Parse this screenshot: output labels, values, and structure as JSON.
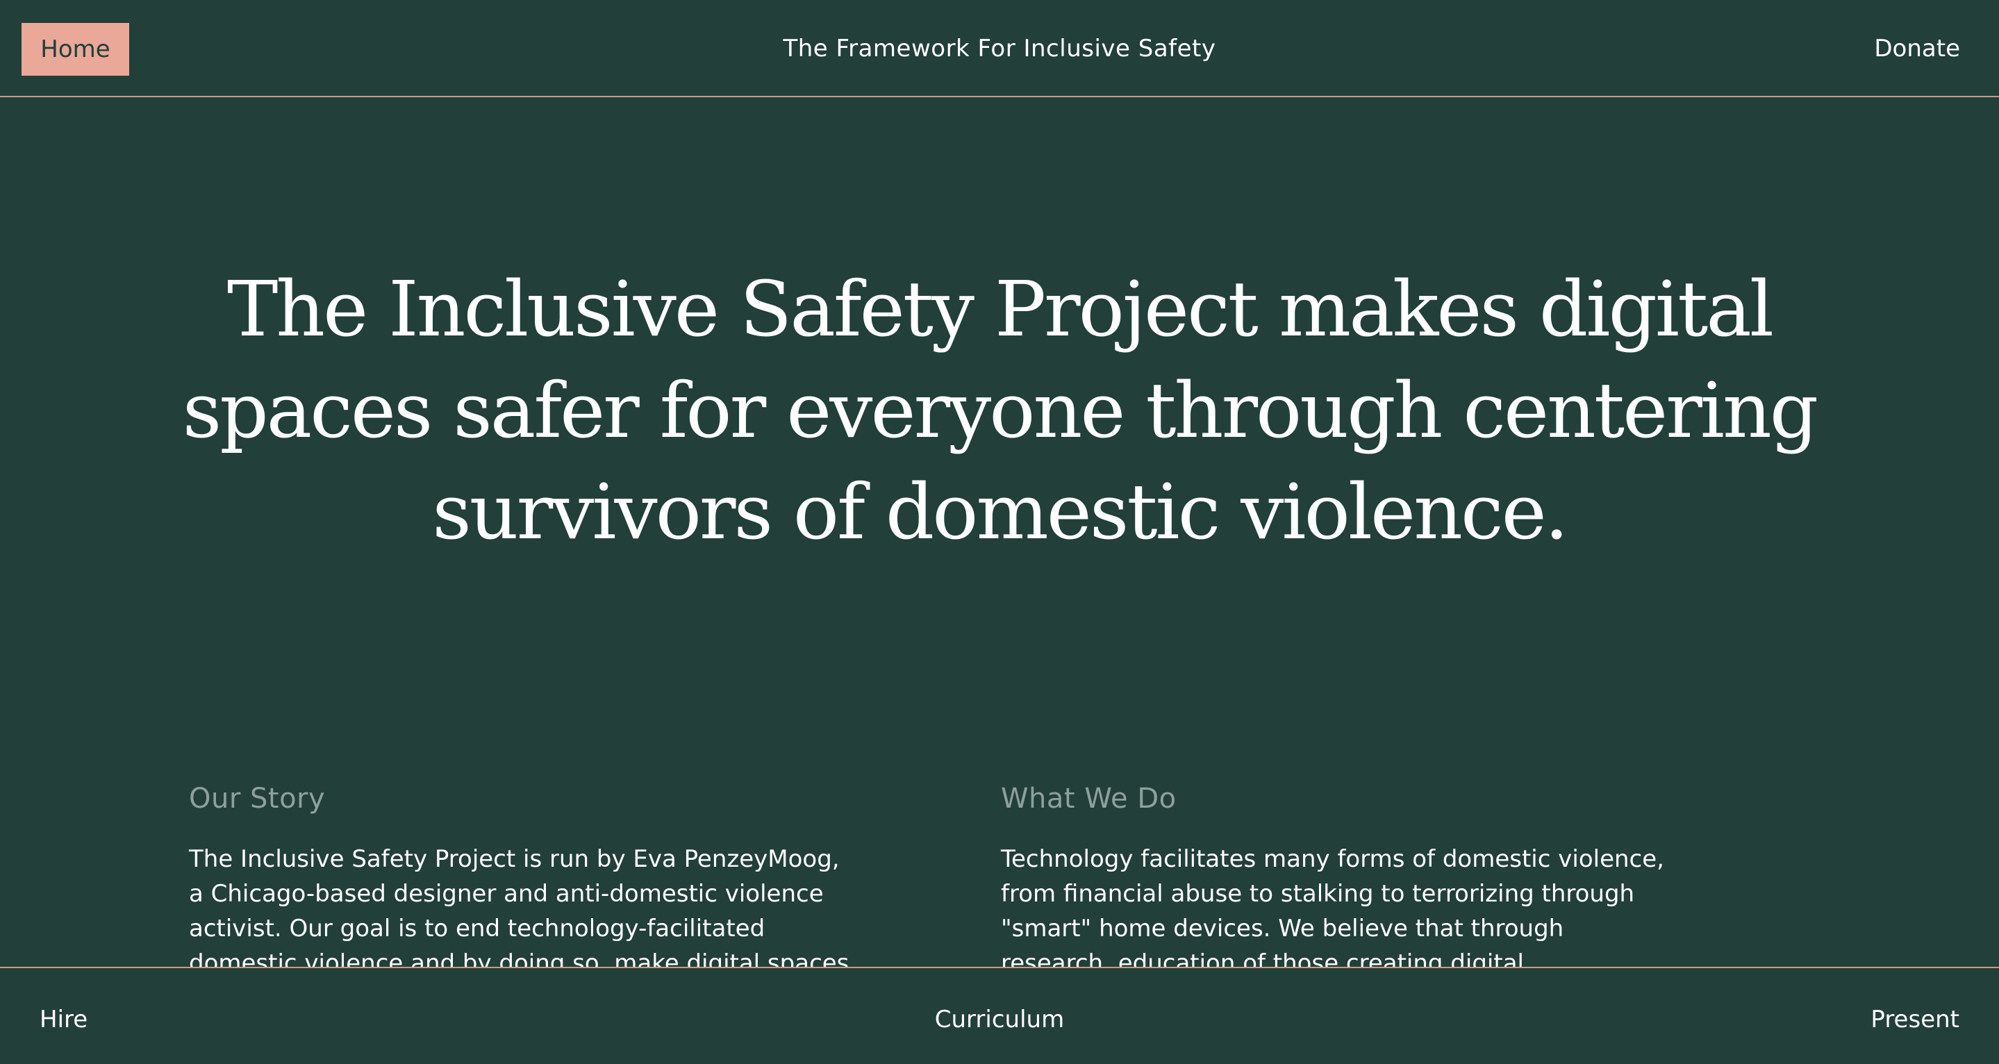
{
  "nav": {
    "home_label": "Home",
    "site_title": "The Framework For Inclusive Safety",
    "donate_label": "Donate"
  },
  "hero": {
    "headline": "The Inclusive Safety Project makes digital spaces safer for everyone through centering survivors of domestic violence."
  },
  "sections": {
    "our_story": {
      "heading": "Our Story",
      "body": "The Inclusive Safety Project is run by Eva PenzeyMoog, a Chicago-based designer and anti-domestic violence activist. Our goal is to end technology-facilitated domestic violence and by doing so, make digital spaces"
    },
    "what_we_do": {
      "heading": "What We Do",
      "body": "Technology facilitates many forms of domestic violence, from financial abuse to stalking to terrorizing through \"smart\" home devices. We believe that through research, education of those creating digital"
    }
  },
  "footer_nav": {
    "hire_label": "Hire",
    "curriculum_label": "Curriculum",
    "present_label": "Present"
  },
  "colors": {
    "background": "#223f39",
    "accent": "#e9a898",
    "divider": "#c79a8c",
    "muted_heading": "#8fa09b",
    "text": "#ffffff"
  }
}
